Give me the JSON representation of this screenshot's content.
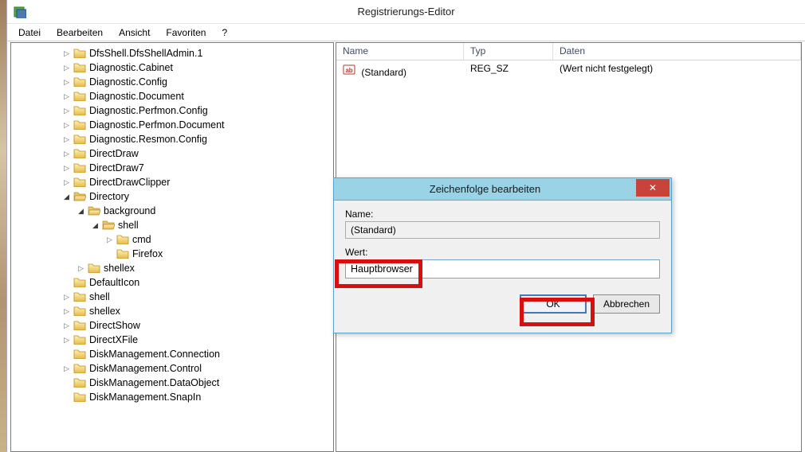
{
  "window_title": "Registrierungs-Editor",
  "menu": {
    "file": "Datei",
    "edit": "Bearbeiten",
    "view": "Ansicht",
    "fav": "Favoriten",
    "help": "?"
  },
  "tree": [
    {
      "indent": 0,
      "toggle": "▷",
      "label": "DfsShell.DfsShellAdmin.1"
    },
    {
      "indent": 0,
      "toggle": "▷",
      "label": "Diagnostic.Cabinet"
    },
    {
      "indent": 0,
      "toggle": "▷",
      "label": "Diagnostic.Config"
    },
    {
      "indent": 0,
      "toggle": "▷",
      "label": "Diagnostic.Document"
    },
    {
      "indent": 0,
      "toggle": "▷",
      "label": "Diagnostic.Perfmon.Config"
    },
    {
      "indent": 0,
      "toggle": "▷",
      "label": "Diagnostic.Perfmon.Document"
    },
    {
      "indent": 0,
      "toggle": "▷",
      "label": "Diagnostic.Resmon.Config"
    },
    {
      "indent": 0,
      "toggle": "▷",
      "label": "DirectDraw"
    },
    {
      "indent": 0,
      "toggle": "▷",
      "label": "DirectDraw7"
    },
    {
      "indent": 0,
      "toggle": "▷",
      "label": "DirectDrawClipper"
    },
    {
      "indent": 0,
      "toggle": "◢",
      "label": "Directory",
      "open": true
    },
    {
      "indent": 1,
      "toggle": "◢",
      "label": "background",
      "open": true
    },
    {
      "indent": 2,
      "toggle": "◢",
      "label": "shell",
      "open": true
    },
    {
      "indent": 3,
      "toggle": "▷",
      "label": "cmd"
    },
    {
      "indent": 3,
      "toggle": "",
      "label": "Firefox"
    },
    {
      "indent": 1,
      "toggle": "▷",
      "label": "shellex"
    },
    {
      "indent": 0,
      "toggle": "",
      "label": "DefaultIcon"
    },
    {
      "indent": 0,
      "toggle": "▷",
      "label": "shell"
    },
    {
      "indent": 0,
      "toggle": "▷",
      "label": "shellex"
    },
    {
      "indent": 0,
      "toggle": "▷",
      "label": "DirectShow"
    },
    {
      "indent": 0,
      "toggle": "▷",
      "label": "DirectXFile"
    },
    {
      "indent": 0,
      "toggle": "",
      "label": "DiskManagement.Connection"
    },
    {
      "indent": 0,
      "toggle": "▷",
      "label": "DiskManagement.Control"
    },
    {
      "indent": 0,
      "toggle": "",
      "label": "DiskManagement.DataObject"
    },
    {
      "indent": 0,
      "toggle": "",
      "label": "DiskManagement.SnapIn"
    }
  ],
  "list": {
    "cols": {
      "name": "Name",
      "type": "Typ",
      "data": "Daten"
    },
    "col_widths": {
      "name": 160,
      "type": 112,
      "data": 300
    },
    "rows": [
      {
        "name": "(Standard)",
        "type": "REG_SZ",
        "data": "(Wert nicht festgelegt)"
      }
    ]
  },
  "dialog": {
    "title": "Zeichenfolge bearbeiten",
    "name_label": "Name:",
    "name_value": "(Standard)",
    "value_label": "Wert:",
    "value_value": "Hauptbrowser",
    "ok": "OK",
    "cancel": "Abbrechen"
  }
}
